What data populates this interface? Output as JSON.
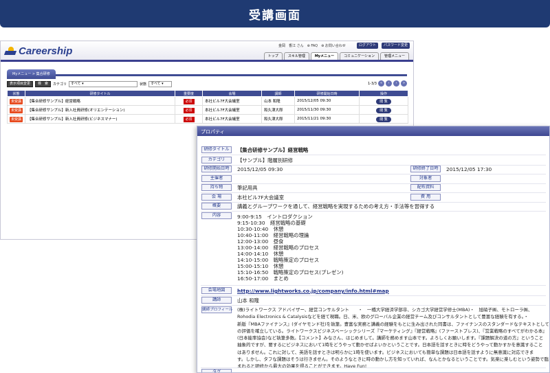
{
  "banner": {
    "title": "受講画面"
  },
  "app": {
    "logo_text": "Careership",
    "user_greeting": "金岡　香江 さん",
    "faq_label": "FAQ",
    "notice_label": "お問い合わせ",
    "logout_label": "ログアウト",
    "password_label": "パスワード変更",
    "tabs": [
      {
        "label": "トップ"
      },
      {
        "label": "スキル管理"
      },
      {
        "label": "Myメニュー"
      },
      {
        "label": "コミュニケーション"
      },
      {
        "label": "管理メニュー"
      }
    ],
    "active_tab": "Myメニュー",
    "breadcrumb": "Myメニュー > 集合研修"
  },
  "toolbar": {
    "display_condition_label": "表示項目変更",
    "search_label": "検　索",
    "category_label": "カテゴリ",
    "category_value": "すべて",
    "status_label": "状態",
    "status_value": "すべて",
    "paging_text": "1-3/3",
    "paging_buttons": [
      "«",
      "‹",
      "›",
      "»"
    ]
  },
  "table": {
    "headers": [
      "状態",
      "研修タイトル",
      "重要度",
      "会場",
      "講師",
      "研修開始日時",
      "操作"
    ],
    "rows": [
      {
        "status": "未受講",
        "title": "【集合研修サンプル】経営戦略",
        "importance": "必須",
        "venue": "本社ビル7F大会議室",
        "lecturer": "山本 和隆",
        "start": "2015/12/05 09:30",
        "action": "閲 覧"
      },
      {
        "status": "未受講",
        "title": "【集合研修サンプル】新入社員研修(オリエンテーション)",
        "importance": "必須",
        "venue": "本社ビル7F大会議室",
        "lecturer": "和久津大郎",
        "start": "2015/11/30 09:30",
        "action": "閲 覧"
      },
      {
        "status": "未受講",
        "title": "【集合研修サンプル】新入社員研修(ビジネスマナー)",
        "importance": "必須",
        "venue": "本社ビル7F大会議室",
        "lecturer": "和久津大郎",
        "start": "2015/11/21 09:30",
        "action": "閲 覧"
      }
    ]
  },
  "property": {
    "window_title": "プロパティ",
    "title_label": "研修タイトル",
    "title_value": "【集合研修サンプル】経営戦略",
    "category_label": "カテゴリ",
    "category_value": "【サンプル】階層別研修",
    "start_label": "研修開始日時",
    "start_value": "2015/12/05 09:30",
    "end_label": "研修終了日時",
    "end_value": "2015/12/05 17:30",
    "organizer_label": "主催者",
    "target_label": "対象者",
    "belongings_label": "持ち物",
    "belongings_value": "筆記用具",
    "materials_label": "配布資料",
    "venue_label": "会 場",
    "venue_value": "本社ビル7F大会議室",
    "cost_label": "費 用",
    "overview_label": "概要",
    "overview_value": "講義とグループワークを通して、経営戦略を実現するための考え方・手法等を習得する",
    "content_label": "内容",
    "content_lines": [
      "9:00-9:15　イントロダクション",
      "9:15-10:30　経営戦略の基礎",
      "10:30-10:40　休憩",
      "10:40-11:00　経営戦略の理論",
      "12:00-13:00　昼食",
      "13:00-14:00　経営戦略のプロセス",
      "14:00-14:10　休憩",
      "14:10-15:00　戦略策定のプロセス",
      "15:00-15:10　休憩",
      "15:10-16:50　戦略策定のプロセス(プレゼン)",
      "16:50-17:00　まとめ"
    ],
    "venue_map_label": "会場地図",
    "venue_map_url": "http://www.lightworks.co.jp/company/info.html#map",
    "lecturer_label": "講師",
    "lecturer_value": "山本 和隆",
    "profile_label": "講師プロフィール",
    "profile_lines": [
      "(株)ライトワークス アドバイザー、経営コンサルタント　　・　一橋大学経済学部卒、シカゴ大学経営学修士(MBA)・　旭硝子㈱、モトローラ㈱、",
      "Rohodia Electronics & Catalysisなどを経て現職。日、米、欧のグローバル企業の経営チーム及びコンサルタントとして豊富な経験を有する。・",
      "新版『MBAファイナンス』(ダイヤモンド社)を執筆。豊富な実務と講義の経験をもとに生み出された同書は、ファイナンスのスタンダードなテキストとして",
      "の評価を確立している。ライトワークスビジネスベーシックシリーズ『マーケティング』『経営戦略』(ファーストプレス)、『営業戦略のすべてがわかる本』",
      "(日本能率協会)など執筆多数。【コメント】みなさん、はじめまして。講師を務めます山本です。よろしくお願いします。『課題解決の道の方』ということ",
      "抽象的ですが、要するにビジネスにおいて1時をどうやって動かせばよいかということです。日本語を話すときに時をどうやって動かすかを意識すること",
      "はありません。これに対して、英語を話すときは明らかに1時を使います。ビジネスにおいても簡単な課題は日本語を話すように無意識に対応できま",
      "す。しかし、タフな課題はそうは行きません。そのようなときに時の動かし方を知っていれば、なんとかなるということです。気楽に楽しむという姿勢で臨",
      "まれると研修から最大の効果を得ることができます。Have Fun!"
    ],
    "tag_label": "タグ"
  },
  "colors": {
    "banner": "#1f3a72",
    "accent": "#3f4c93",
    "status_red": "#e74a1e",
    "required_red": "#cc0000"
  }
}
